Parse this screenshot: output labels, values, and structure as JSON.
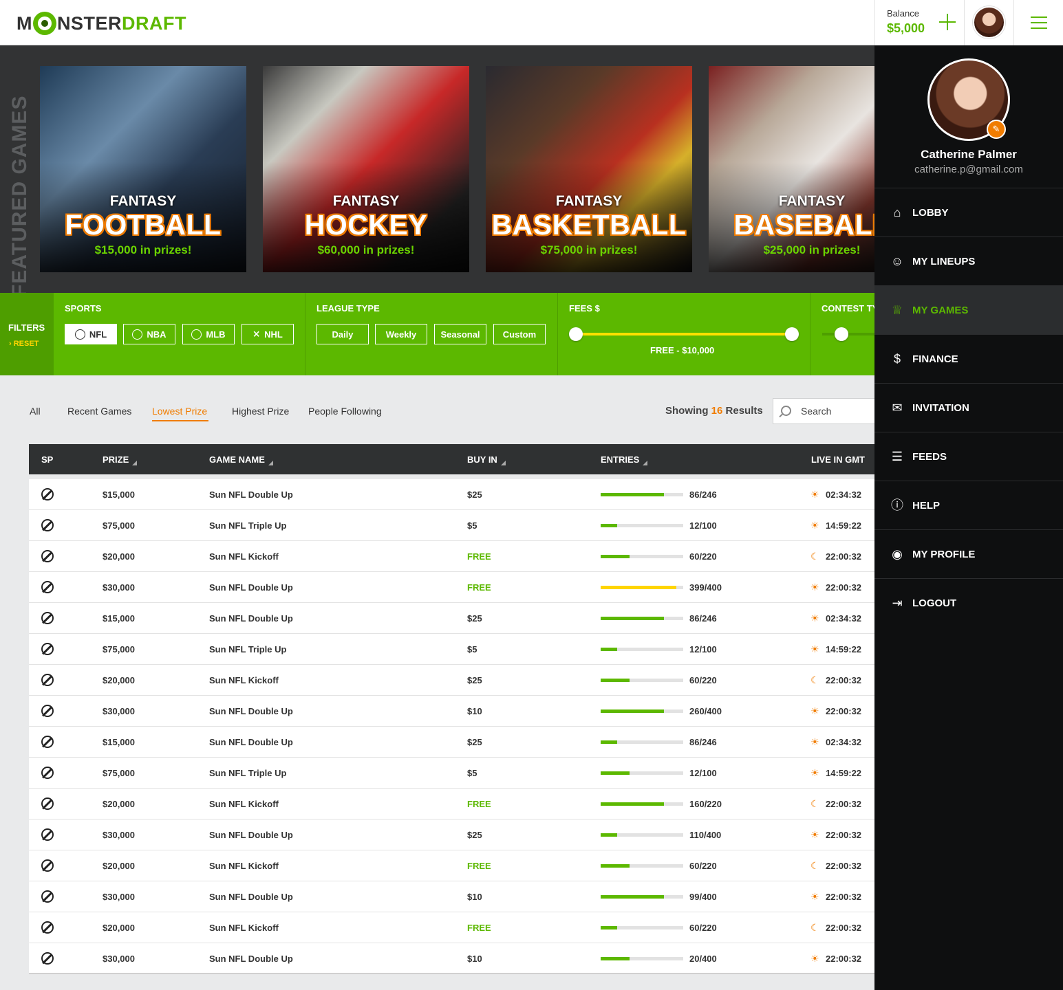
{
  "header": {
    "logo_start": "M",
    "logo_mid": "NSTER",
    "logo_end": "DRAFT",
    "balance_label": "Balance",
    "balance_value": "$5,000"
  },
  "featured": {
    "title": "FEATURED GAMES",
    "cards": [
      {
        "fantasy": "FANTASY",
        "sport": "FOOTBALL",
        "prize": "$15,000 in prizes!",
        "bg": "#3a5a7a"
      },
      {
        "fantasy": "FANTASY",
        "sport": "HOCKEY",
        "prize": "$60,000 in prizes!",
        "bg": "#b02a2a"
      },
      {
        "fantasy": "FANTASY",
        "sport": "BASKETBALL",
        "prize": "$75,000 in prizes!",
        "bg": "#5a3a2a"
      },
      {
        "fantasy": "FANTASY",
        "sport": "BASEBALL",
        "prize": "$25,000 in prizes!",
        "bg": "#8a6a5a"
      }
    ]
  },
  "filters": {
    "label": "FILTERS",
    "reset": "RESET",
    "sports": {
      "label": "SPORTS",
      "options": [
        "NFL",
        "NBA",
        "MLB",
        "NHL"
      ],
      "selected": "NFL"
    },
    "league": {
      "label": "LEAGUE TYPE",
      "options": [
        "Daily",
        "Weekly",
        "Seasonal",
        "Custom"
      ]
    },
    "fees": {
      "label": "FEES $",
      "value": "FREE - $10,000"
    },
    "contest": {
      "label": "CONTEST TY"
    }
  },
  "tabs": [
    "All",
    "Recent Games",
    "Lowest Prize",
    "Highest Prize",
    "People Following"
  ],
  "active_tab": "Lowest Prize",
  "results": {
    "prefix": "Showing",
    "count": "16",
    "suffix": "Results"
  },
  "search": {
    "placeholder": "Search"
  },
  "table": {
    "headers": [
      "SP",
      "PRIZE",
      "GAME NAME",
      "BUY IN",
      "ENTRIES",
      "LIVE IN GMT"
    ],
    "rows": [
      {
        "prize": "$15,000",
        "name": "Sun NFL Double Up",
        "buyin": "$25",
        "entries": "86/246",
        "fill": 0.77,
        "color": "green",
        "time": "02:34:32",
        "tz": "sun"
      },
      {
        "prize": "$75,000",
        "name": "Sun NFL Triple Up",
        "buyin": "$5",
        "entries": "12/100",
        "fill": 0.2,
        "color": "green",
        "time": "14:59:22",
        "tz": "sun"
      },
      {
        "prize": "$20,000",
        "name": "Sun NFL Kickoff",
        "buyin": "FREE",
        "entries": "60/220",
        "fill": 0.35,
        "color": "green",
        "time": "22:00:32",
        "tz": "moon"
      },
      {
        "prize": "$30,000",
        "name": "Sun NFL Double Up",
        "buyin": "FREE",
        "entries": "399/400",
        "fill": 0.92,
        "color": "yellow",
        "time": "22:00:32",
        "tz": "sun"
      },
      {
        "prize": "$15,000",
        "name": "Sun NFL Double Up",
        "buyin": "$25",
        "entries": "86/246",
        "fill": 0.77,
        "color": "green",
        "time": "02:34:32",
        "tz": "sun"
      },
      {
        "prize": "$75,000",
        "name": "Sun NFL Triple Up",
        "buyin": "$5",
        "entries": "12/100",
        "fill": 0.2,
        "color": "green",
        "time": "14:59:22",
        "tz": "sun"
      },
      {
        "prize": "$20,000",
        "name": "Sun NFL Kickoff",
        "buyin": "$25",
        "entries": "60/220",
        "fill": 0.35,
        "color": "green",
        "time": "22:00:32",
        "tz": "moon"
      },
      {
        "prize": "$30,000",
        "name": "Sun NFL Double Up",
        "buyin": "$10",
        "entries": "260/400",
        "fill": 0.77,
        "color": "green",
        "time": "22:00:32",
        "tz": "sun"
      },
      {
        "prize": "$15,000",
        "name": "Sun NFL Double Up",
        "buyin": "$25",
        "entries": "86/246",
        "fill": 0.2,
        "color": "green",
        "time": "02:34:32",
        "tz": "sun"
      },
      {
        "prize": "$75,000",
        "name": "Sun NFL Triple Up",
        "buyin": "$5",
        "entries": "12/100",
        "fill": 0.35,
        "color": "green",
        "time": "14:59:22",
        "tz": "sun"
      },
      {
        "prize": "$20,000",
        "name": "Sun NFL Kickoff",
        "buyin": "FREE",
        "entries": "160/220",
        "fill": 0.77,
        "color": "green",
        "time": "22:00:32",
        "tz": "moon"
      },
      {
        "prize": "$30,000",
        "name": "Sun NFL Double Up",
        "buyin": "$25",
        "entries": "110/400",
        "fill": 0.2,
        "color": "green",
        "time": "22:00:32",
        "tz": "sun"
      },
      {
        "prize": "$20,000",
        "name": "Sun NFL Kickoff",
        "buyin": "FREE",
        "entries": "60/220",
        "fill": 0.35,
        "color": "green",
        "time": "22:00:32",
        "tz": "moon"
      },
      {
        "prize": "$30,000",
        "name": "Sun NFL Double Up",
        "buyin": "$10",
        "entries": "99/400",
        "fill": 0.77,
        "color": "green",
        "time": "22:00:32",
        "tz": "sun"
      },
      {
        "prize": "$20,000",
        "name": "Sun NFL Kickoff",
        "buyin": "FREE",
        "entries": "60/220",
        "fill": 0.2,
        "color": "green",
        "time": "22:00:32",
        "tz": "moon"
      },
      {
        "prize": "$30,000",
        "name": "Sun NFL Double Up",
        "buyin": "$10",
        "entries": "20/400",
        "fill": 0.35,
        "color": "green",
        "time": "22:00:32",
        "tz": "sun"
      }
    ]
  },
  "side_menu": {
    "user_name": "Catherine Palmer",
    "user_email": "catherine.p@gmail.com",
    "items": [
      {
        "label": "LOBBY",
        "icon": "home-icon",
        "glyph": "⌂"
      },
      {
        "label": "MY LINEUPS",
        "icon": "people-icon",
        "glyph": "☺"
      },
      {
        "label": "MY GAMES",
        "icon": "trophy-icon",
        "glyph": "♕"
      },
      {
        "label": "FINANCE",
        "icon": "dollar-icon",
        "glyph": "$"
      },
      {
        "label": "INVITATION",
        "icon": "envelope-icon",
        "glyph": "✉"
      },
      {
        "label": "FEEDS",
        "icon": "list-icon",
        "glyph": "☰"
      },
      {
        "label": "HELP",
        "icon": "info-icon",
        "glyph": "ⓘ"
      },
      {
        "label": "MY PROFILE",
        "icon": "user-icon",
        "glyph": "◉"
      },
      {
        "label": "LOGOUT",
        "icon": "logout-icon",
        "glyph": "⇥"
      }
    ],
    "active": "MY GAMES"
  },
  "colors": {
    "brand_green": "#5cb800",
    "accent_orange": "#f07c00",
    "slider_yellow": "#ffe000"
  }
}
